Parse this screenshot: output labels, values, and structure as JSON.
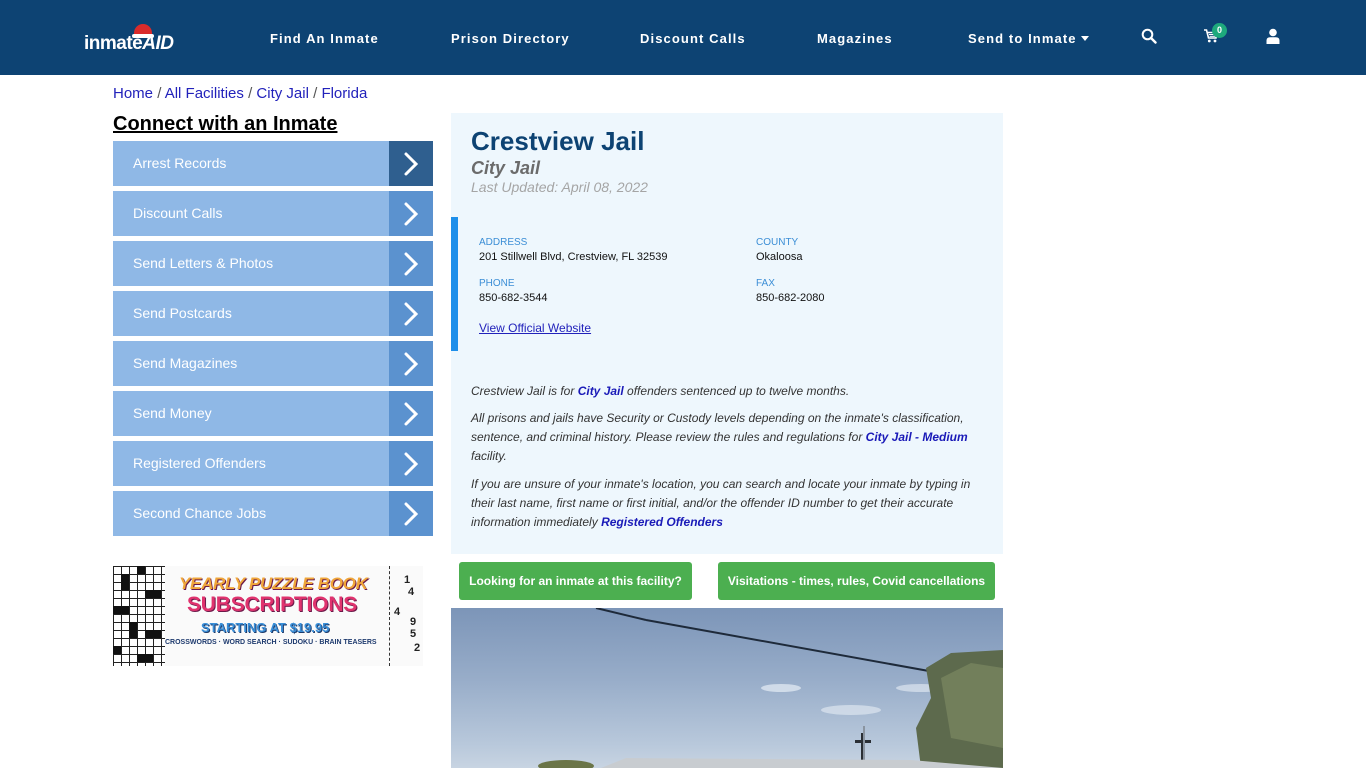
{
  "header": {
    "logo_text": "inmate",
    "logo_text_accent": "AID",
    "nav": [
      {
        "label": "Find An Inmate"
      },
      {
        "label": "Prison Directory"
      },
      {
        "label": "Discount Calls"
      },
      {
        "label": "Magazines"
      },
      {
        "label": "Send to Inmate",
        "has_dropdown": true
      }
    ],
    "icons": [
      "search-icon",
      "cart-icon",
      "user-icon"
    ],
    "cart_count": "0"
  },
  "breadcrumb": {
    "items": [
      "Home",
      "All Facilities",
      "City Jail",
      "Florida"
    ],
    "separator": "/"
  },
  "sidebar": {
    "title": "Connect with an Inmate",
    "items": [
      {
        "label": "Arrest Records",
        "active": true
      },
      {
        "label": "Discount Calls"
      },
      {
        "label": "Send Letters & Photos"
      },
      {
        "label": "Send Postcards"
      },
      {
        "label": "Send Magazines"
      },
      {
        "label": "Send Money"
      },
      {
        "label": "Registered Offenders"
      },
      {
        "label": "Second Chance Jobs"
      }
    ],
    "ad": {
      "line1": "YEARLY PUZZLE BOOK",
      "line2": "SUBSCRIPTIONS",
      "line3": "STARTING AT $19.95",
      "line4": "CROSSWORDS · WORD SEARCH · SUDOKU · BRAIN TEASERS",
      "sudoku_numbers": [
        "1",
        "4",
        "4",
        "9",
        "5",
        "2"
      ]
    }
  },
  "facility": {
    "name": "Crestview Jail",
    "type": "City Jail",
    "last_updated": "Last Updated: April 08, 2022",
    "info": {
      "address_label": "ADDRESS",
      "address": "201 Stillwell Blvd, Crestview, FL 32539",
      "county_label": "COUNTY",
      "county": "Okaloosa",
      "phone_label": "PHONE",
      "phone": "850-682-3544",
      "fax_label": "FAX",
      "fax": "850-682-2080",
      "website_link": "View Official Website"
    },
    "description": {
      "p1_before": "Crestview Jail is for ",
      "p1_link": "City Jail",
      "p1_after": " offenders sentenced up to twelve months.",
      "p2_before": "All prisons and jails have Security or Custody levels depending on the inmate's classification, sentence, and criminal history. Please review the rules and regulations for ",
      "p2_link": "City Jail - Medium",
      "p2_after": " facility.",
      "p3_before": "If you are unsure of your inmate's location, you can search and locate your inmate by typing in their last name, first name or first initial, and/or the offender ID number to get their accurate information immediately ",
      "p3_link": "Registered Offenders"
    },
    "buttons": {
      "find_inmate": "Looking for an inmate at this facility?",
      "visitations": "Visitations - times, rules, Covid cancellations"
    }
  },
  "colors": {
    "navbar": "#0d4373",
    "sidebar_item": "#8fb8e6",
    "sidebar_arrow": "#5b92cf",
    "sidebar_arrow_active": "#2f5f8f",
    "card_bg": "#eef7fd",
    "accent_blue": "#1e8fea",
    "green_button": "#4caf50",
    "link": "#2222bb"
  }
}
